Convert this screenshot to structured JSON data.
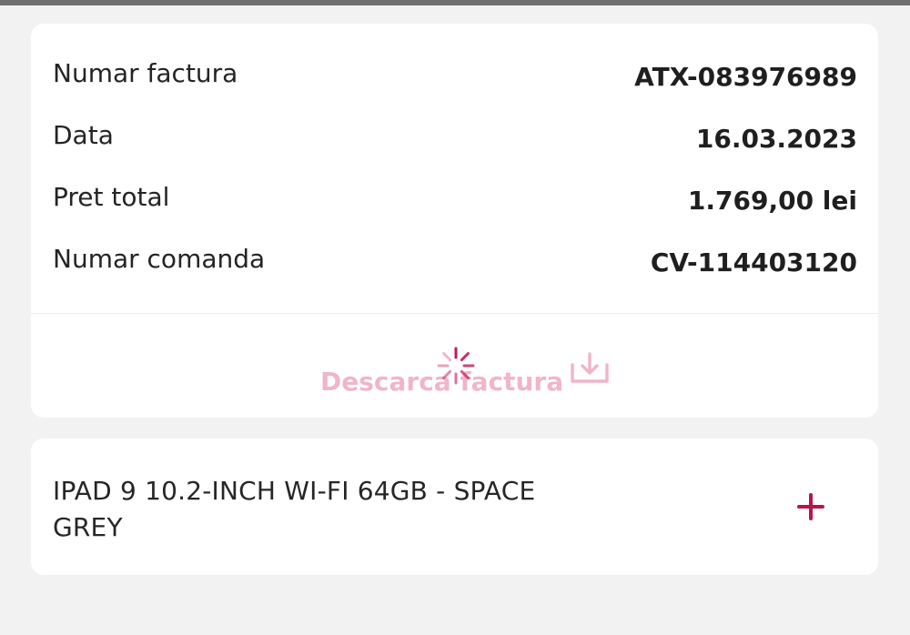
{
  "invoice": {
    "rows": [
      {
        "label": "Numar factura",
        "value": "ATX-083976989"
      },
      {
        "label": "Data",
        "value": "16.03.2023"
      },
      {
        "label": "Pret total",
        "value": "1.769,00 lei"
      },
      {
        "label": "Numar comanda",
        "value": "CV-114403120"
      }
    ],
    "download_label": "Descarca factura",
    "download_icon": "download-icon",
    "loading_icon": "loading-spinner-icon"
  },
  "product": {
    "name": "IPAD 9 10.2-INCH WI-FI 64GB - SPACE GREY",
    "expand_icon": "plus-icon"
  },
  "colors": {
    "accent": "#b5174c",
    "accent_faded": "#f0b5c9",
    "background": "#f2f2f2",
    "card": "#ffffff"
  }
}
